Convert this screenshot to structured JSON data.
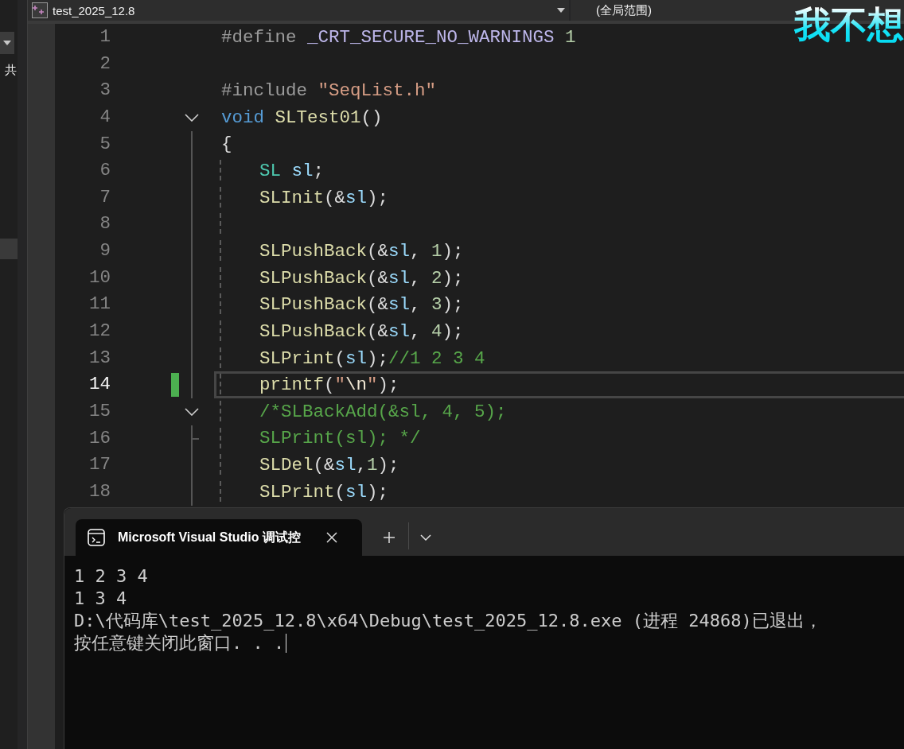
{
  "side_panel": {
    "label": "共"
  },
  "top_bar": {
    "project": "test_2025_12.8",
    "scope": "(全局范围)"
  },
  "caption": "我不想",
  "editor": {
    "lines": [
      {
        "number": "1",
        "indented": false,
        "current": false,
        "changed": false,
        "expanded": false,
        "tokens": [
          {
            "kind": "pre",
            "text": "#define "
          },
          {
            "kind": "macro",
            "text": "_CRT_SECURE_NO_WARNINGS "
          },
          {
            "kind": "number",
            "text": "1"
          }
        ]
      },
      {
        "number": "2",
        "indented": false,
        "current": false,
        "changed": false,
        "expanded": false
      },
      {
        "number": "3",
        "indented": false,
        "current": false,
        "changed": false,
        "expanded": false,
        "tokens": [
          {
            "kind": "pre",
            "text": "#include "
          },
          {
            "kind": "string",
            "text": "\"SeqList.h\""
          }
        ]
      },
      {
        "number": "4",
        "indented": false,
        "current": false,
        "changed": false,
        "expanded": true,
        "tokens": [
          {
            "kind": "keyword",
            "text": "void "
          },
          {
            "kind": "function",
            "text": "SLTest01"
          },
          {
            "kind": "plain",
            "text": "()"
          }
        ]
      },
      {
        "number": "5",
        "indented": false,
        "current": false,
        "changed": false,
        "expanded": false,
        "tokens": [
          {
            "kind": "plain",
            "text": "{"
          }
        ]
      },
      {
        "number": "6",
        "indented": true,
        "current": false,
        "changed": false,
        "expanded": false,
        "tokens": [
          {
            "kind": "type",
            "text": "SL "
          },
          {
            "kind": "var",
            "text": "sl"
          },
          {
            "kind": "plain",
            "text": ";"
          }
        ]
      },
      {
        "number": "7",
        "indented": true,
        "current": false,
        "changed": false,
        "expanded": false,
        "tokens": [
          {
            "kind": "function",
            "text": "SLInit"
          },
          {
            "kind": "plain",
            "text": "(&"
          },
          {
            "kind": "var",
            "text": "sl"
          },
          {
            "kind": "plain",
            "text": ");"
          }
        ]
      },
      {
        "number": "8",
        "indented": true,
        "current": false,
        "changed": false,
        "expanded": false
      },
      {
        "number": "9",
        "indented": true,
        "current": false,
        "changed": false,
        "expanded": false,
        "tokens": [
          {
            "kind": "function",
            "text": "SLPushBack"
          },
          {
            "kind": "plain",
            "text": "(&"
          },
          {
            "kind": "var",
            "text": "sl"
          },
          {
            "kind": "plain",
            "text": ", "
          },
          {
            "kind": "number",
            "text": "1"
          },
          {
            "kind": "plain",
            "text": ");"
          }
        ]
      },
      {
        "number": "10",
        "indented": true,
        "current": false,
        "changed": false,
        "expanded": false,
        "tokens": [
          {
            "kind": "function",
            "text": "SLPushBack"
          },
          {
            "kind": "plain",
            "text": "(&"
          },
          {
            "kind": "var",
            "text": "sl"
          },
          {
            "kind": "plain",
            "text": ", "
          },
          {
            "kind": "number",
            "text": "2"
          },
          {
            "kind": "plain",
            "text": ");"
          }
        ]
      },
      {
        "number": "11",
        "indented": true,
        "current": false,
        "changed": false,
        "expanded": false,
        "tokens": [
          {
            "kind": "function",
            "text": "SLPushBack"
          },
          {
            "kind": "plain",
            "text": "(&"
          },
          {
            "kind": "var",
            "text": "sl"
          },
          {
            "kind": "plain",
            "text": ", "
          },
          {
            "kind": "number",
            "text": "3"
          },
          {
            "kind": "plain",
            "text": ");"
          }
        ]
      },
      {
        "number": "12",
        "indented": true,
        "current": false,
        "changed": false,
        "expanded": false,
        "tokens": [
          {
            "kind": "function",
            "text": "SLPushBack"
          },
          {
            "kind": "plain",
            "text": "(&"
          },
          {
            "kind": "var",
            "text": "sl"
          },
          {
            "kind": "plain",
            "text": ", "
          },
          {
            "kind": "number",
            "text": "4"
          },
          {
            "kind": "plain",
            "text": ");"
          }
        ]
      },
      {
        "number": "13",
        "indented": true,
        "current": false,
        "changed": false,
        "expanded": false,
        "tokens": [
          {
            "kind": "function",
            "text": "SLPrint"
          },
          {
            "kind": "plain",
            "text": "("
          },
          {
            "kind": "var",
            "text": "sl"
          },
          {
            "kind": "plain",
            "text": ");"
          },
          {
            "kind": "comment",
            "text": "//1 2 3 4"
          }
        ]
      },
      {
        "number": "14",
        "indented": true,
        "current": true,
        "changed": true,
        "expanded": false,
        "tokens": [
          {
            "kind": "function",
            "text": "printf"
          },
          {
            "kind": "plain",
            "text": "("
          },
          {
            "kind": "string",
            "text": "\""
          },
          {
            "kind": "escape",
            "text": "\\n"
          },
          {
            "kind": "string",
            "text": "\""
          },
          {
            "kind": "plain",
            "text": ");"
          }
        ]
      },
      {
        "number": "15",
        "indented": true,
        "current": false,
        "changed": false,
        "expanded": true,
        "tokens": [
          {
            "kind": "comment",
            "text": "/*SLBackAdd(&sl, 4, 5);"
          }
        ]
      },
      {
        "number": "16",
        "indented": true,
        "current": false,
        "changed": false,
        "expanded": false,
        "tokens": [
          {
            "kind": "comment",
            "text": "SLPrint(sl); */"
          }
        ]
      },
      {
        "number": "17",
        "indented": true,
        "current": false,
        "changed": false,
        "expanded": false,
        "tokens": [
          {
            "kind": "function",
            "text": "SLDel"
          },
          {
            "kind": "plain",
            "text": "(&"
          },
          {
            "kind": "var",
            "text": "sl"
          },
          {
            "kind": "plain",
            "text": ","
          },
          {
            "kind": "number",
            "text": "1"
          },
          {
            "kind": "plain",
            "text": ");"
          }
        ]
      },
      {
        "number": "18",
        "indented": true,
        "current": false,
        "changed": false,
        "expanded": false,
        "tokens": [
          {
            "kind": "function",
            "text": "SLPrint"
          },
          {
            "kind": "plain",
            "text": "("
          },
          {
            "kind": "var",
            "text": "sl"
          },
          {
            "kind": "plain",
            "text": ");"
          }
        ]
      }
    ]
  },
  "console": {
    "tab_title": "Microsoft Visual Studio 调试控",
    "lines": [
      {
        "text": "1 2 3 4",
        "cursor": false
      },
      {
        "text": "1 3 4",
        "cursor": false
      },
      {
        "text": "D:\\代码库\\test_2025_12.8\\x64\\Debug\\test_2025_12.8.exe (进程 24868)已退出，",
        "cursor": false
      },
      {
        "text": "按任意键关闭此窗口. . .",
        "cursor": true
      }
    ]
  }
}
